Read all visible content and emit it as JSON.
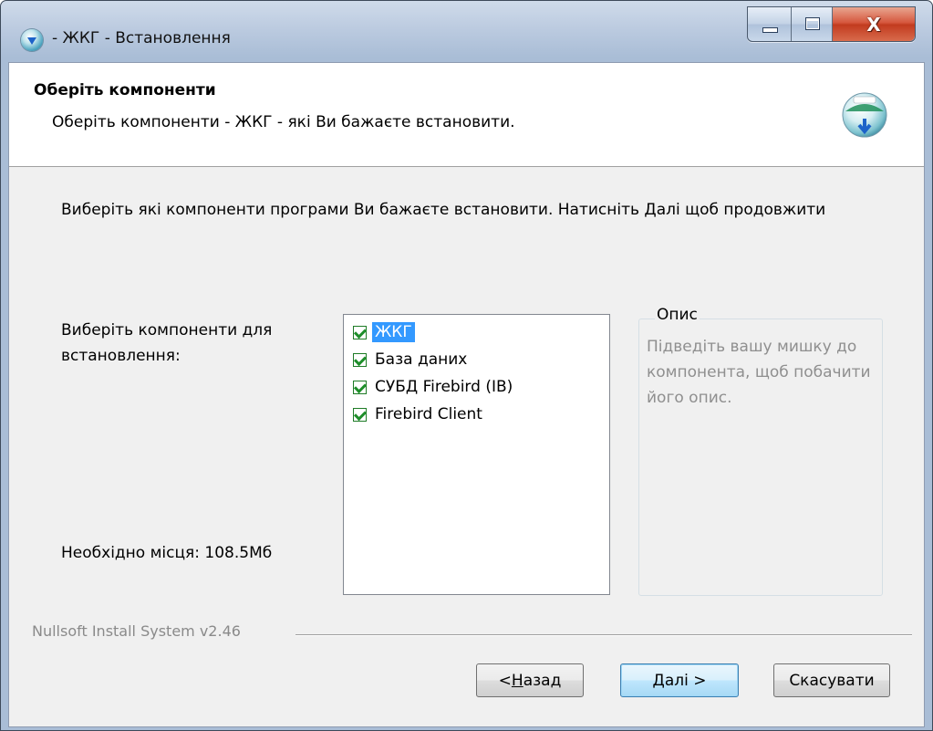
{
  "window": {
    "title": "- ЖКГ - Встановлення",
    "close_glyph": "X"
  },
  "header": {
    "title": "Оберіть компоненти",
    "subtitle": "Оберіть компоненти - ЖКГ - які Ви бажаєте встановити.",
    "logo_icon": "installer-logo-icon"
  },
  "body": {
    "intro": "Виберіть які компоненти програми Ви бажаєте встановити. Натисніть Далі щоб продовжити",
    "components_label": "Виберіть компоненти для встановлення:",
    "space_required": "Необхідно місця: 108.5Мб"
  },
  "components": [
    {
      "label": "ЖКГ",
      "checked": true,
      "selected": true
    },
    {
      "label": "База даних",
      "checked": true,
      "selected": false
    },
    {
      "label": "СУБД Firebird (IB)",
      "checked": true,
      "selected": false
    },
    {
      "label": "Firebird Client",
      "checked": true,
      "selected": false
    }
  ],
  "description": {
    "legend": "Опис",
    "text": "Підведіть вашу мишку до компонента, щоб побачити його опис."
  },
  "footer": {
    "branding": "Nullsoft Install System v2.46",
    "back_prefix": "< ",
    "back_accel": "Н",
    "back_rest": "азад",
    "next_label": "Далі >",
    "cancel_label": "Скасувати"
  },
  "colors": {
    "selection": "#3399ff",
    "checkmark": "#1e8e2a",
    "close_button": "#c23b1f"
  }
}
